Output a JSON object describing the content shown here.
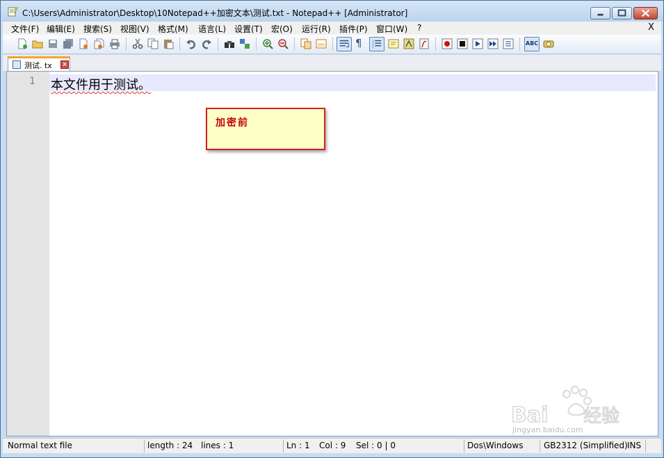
{
  "window": {
    "title": "C:\\Users\\Administrator\\Desktop\\10Notepad++加密文本\\测试.txt - Notepad++ [Administrator]"
  },
  "menu": {
    "items": [
      "文件(F)",
      "编辑(E)",
      "搜索(S)",
      "视图(V)",
      "格式(M)",
      "语言(L)",
      "设置(T)",
      "宏(O)",
      "运行(R)",
      "插件(P)",
      "窗口(W)",
      "?"
    ],
    "close_label": "X"
  },
  "toolbar": {
    "icons": [
      "new-file-icon",
      "open-file-icon",
      "save-icon",
      "save-all-icon",
      "close-icon",
      "close-all-icon",
      "print-icon",
      "cut-icon",
      "copy-icon",
      "paste-icon",
      "undo-icon",
      "redo-icon",
      "find-icon",
      "replace-icon",
      "zoom-in-icon",
      "zoom-out-icon",
      "sync-vertical-icon",
      "sync-horizontal-icon",
      "word-wrap-icon",
      "show-all-chars-icon",
      "indent-guide-icon",
      "user-language-icon",
      "doc-map-icon",
      "function-list-icon",
      "macro-record-icon",
      "macro-stop-icon",
      "macro-play-icon",
      "macro-run-multiple-icon",
      "macro-save-icon",
      "spell-check-icon",
      "launch-in-browser-icon"
    ],
    "show_all_chars_glyph": "¶",
    "spell_check_glyph": "ABC"
  },
  "tab": {
    "label": "测试. tx"
  },
  "editor": {
    "line_numbers": [
      "1"
    ],
    "lines": [
      "本文件用于测试。"
    ]
  },
  "annotation": {
    "text": "加密前"
  },
  "status": {
    "file_type": "Normal text file",
    "length": "length : 24",
    "lines": "lines : 1",
    "ln": "Ln : 1",
    "col": "Col : 9",
    "sel": "Sel : 0 | 0",
    "eol": "Dos\\Windows",
    "encoding": "GB2312 (Simplified)",
    "mode": "INS"
  },
  "watermark": {
    "text": "jingyan.baidu.com"
  },
  "colors": {
    "annotation_border": "#d81e1e",
    "annotation_background": "#ffffc8",
    "annotation_text": "#c00000",
    "current_line": "#e8e8ff",
    "tab_accent": "#f5a623"
  }
}
